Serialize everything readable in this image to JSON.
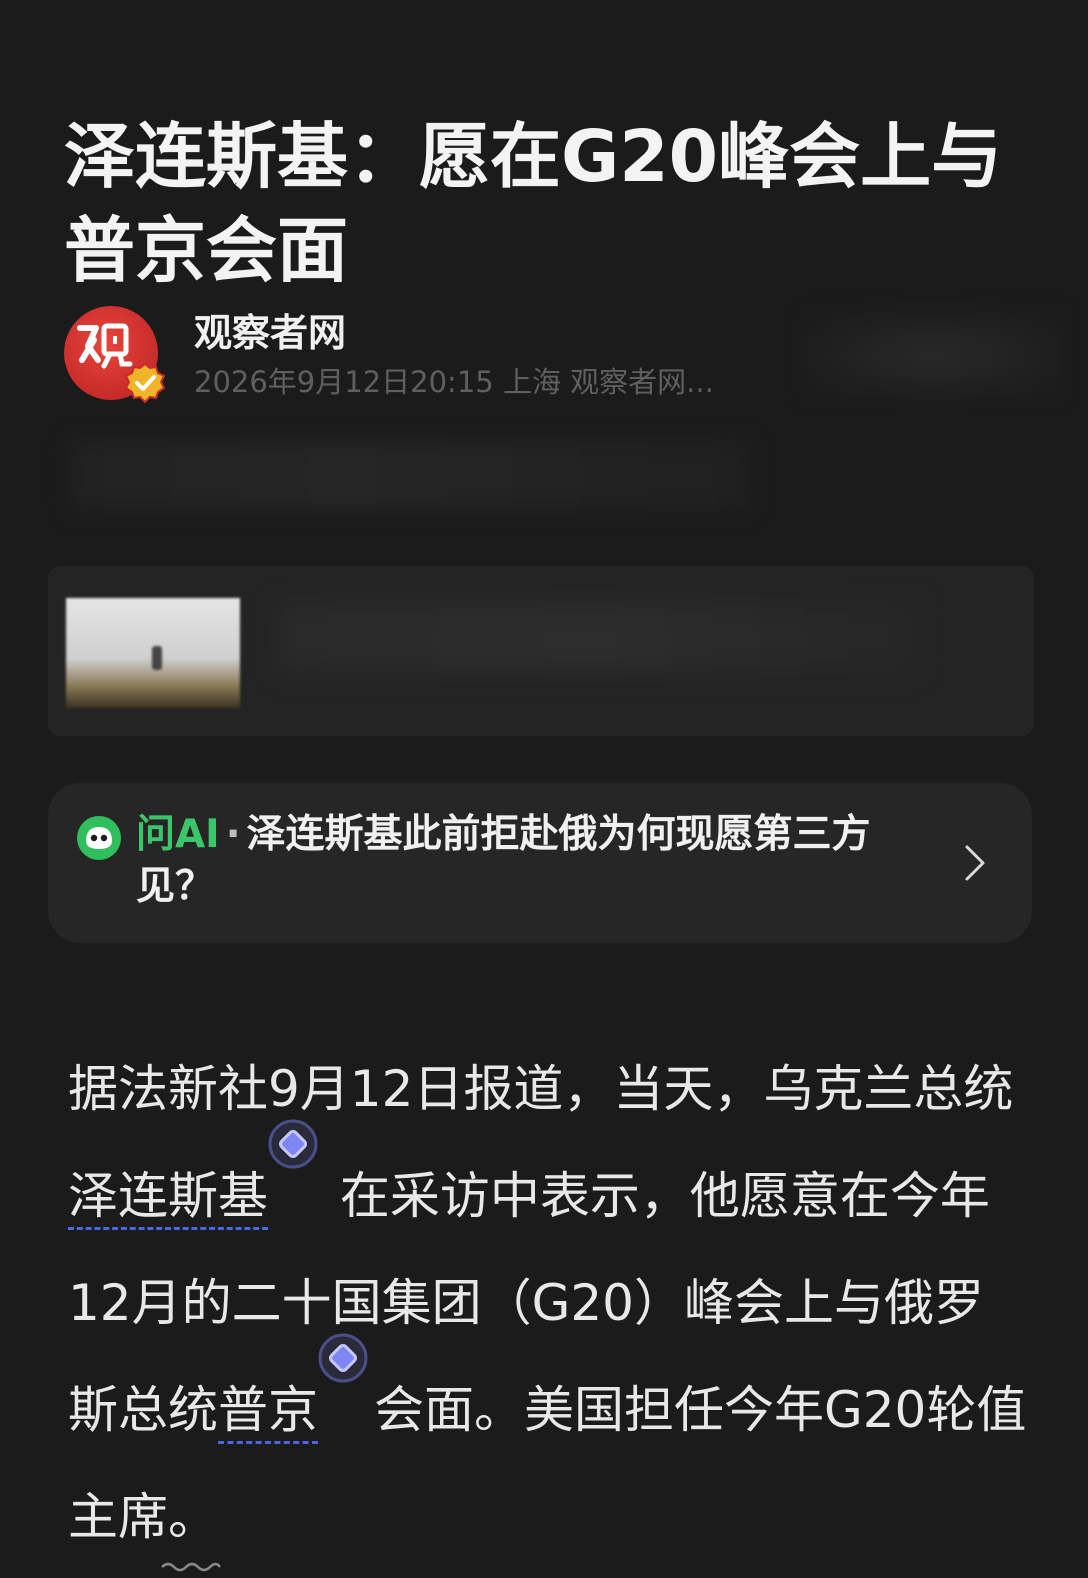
{
  "article": {
    "title": "泽连斯基：愿在G20峰会上与普京会面",
    "author": {
      "name": "观察者网",
      "meta": "2026年9月12日20:15 上海 观察者网..."
    },
    "ai_prompt": {
      "label": "问AI",
      "separator": "·",
      "question": "泽连斯基此前拒赴俄为何现愿第三方见？"
    },
    "body": {
      "p1_a": "据法新社9月12日报道，当天，乌克兰总统",
      "entity1": "泽连斯基",
      "p1_b": " 在采访中表示，他愿意在今年12月的二十国集团（G20）峰会上与俄罗斯总统",
      "entity2": "普京",
      "p1_c": "会面。美国担任今年G20轮值主席。"
    }
  },
  "colors": {
    "background": "#1b1b1b",
    "card": "#262626",
    "ai_green": "#3cc66b",
    "entity_underline": "#4a66e0",
    "avatar_red": "#d9392f"
  },
  "icons": {
    "avatar_logo": "guancha-logo",
    "verified": "verified-badge-icon",
    "ai": "ai-assistant-icon",
    "chevron": "chevron-right-icon",
    "entity": "entity-diamond-icon"
  }
}
